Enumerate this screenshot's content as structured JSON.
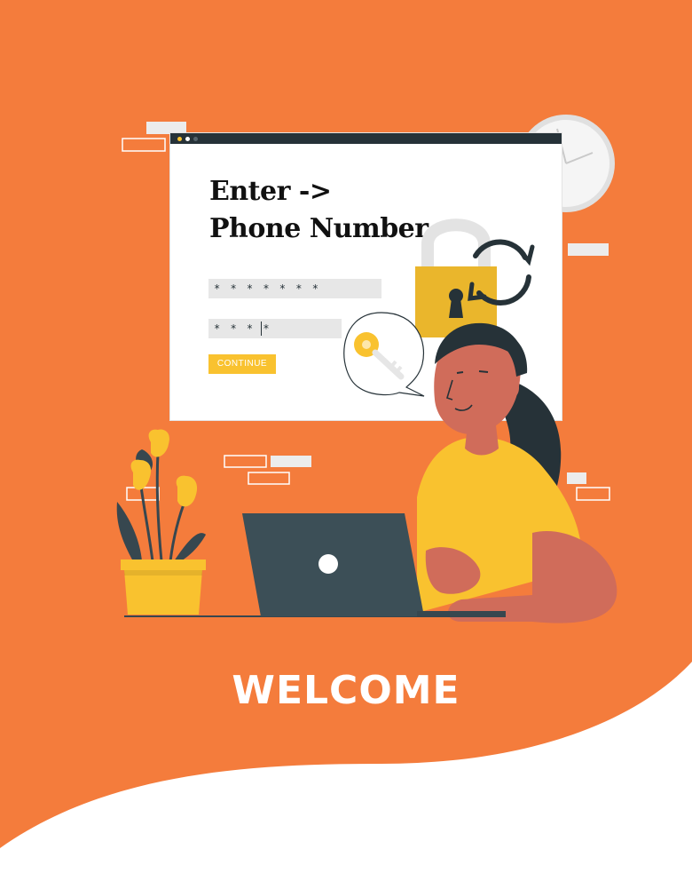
{
  "colors": {
    "background": "#f47c3c",
    "accent_yellow": "#f9c22f",
    "dark": "#263238",
    "skin": "#d06c5a",
    "card": "#ffffff"
  },
  "login_card": {
    "title_line1": "Enter   ->",
    "title_line2": "Phone Number",
    "field_one_value": "* * * * * * *",
    "field_two_value": "* * * *",
    "continue_label": "CONTINUE"
  },
  "welcome_text": "WELCOME",
  "icons": [
    "padlock-icon",
    "refresh-arrows-icon",
    "key-icon",
    "clock-icon",
    "laptop-icon",
    "plant-icon"
  ]
}
